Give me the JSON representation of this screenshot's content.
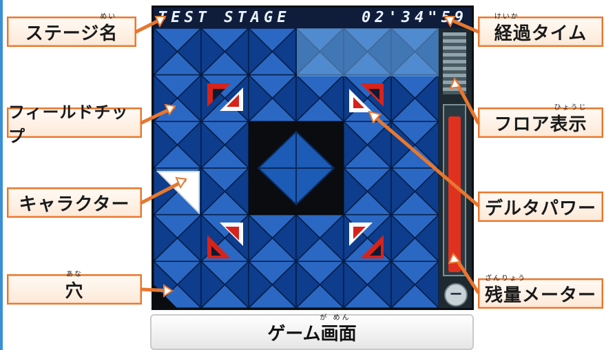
{
  "hud": {
    "stage_name": "TEST STAGE",
    "elapsed_time": "02'34\"59"
  },
  "labels": {
    "stage_name": {
      "text": "ステージ名",
      "ruby": "めい"
    },
    "field_chip": {
      "text": "フィールドチップ"
    },
    "character": {
      "text": "キャラクター"
    },
    "hole": {
      "text": "穴",
      "ruby": "あな"
    },
    "elapsed_time": {
      "text": "経過タイム",
      "ruby": "けいか"
    },
    "floor_display": {
      "text": "フロア表示",
      "ruby": "ひょうじ"
    },
    "delta_power": {
      "text": "デルタパワー"
    },
    "remaining_meter": {
      "text": "残量メーター",
      "ruby": "ざんりょう"
    }
  },
  "caption": {
    "text": "ゲーム画面",
    "ruby": "が めん"
  },
  "meter": {
    "minus_symbol": "−",
    "level": 0.92
  },
  "colors": {
    "label_border": "#e8772e",
    "tile_dark": "#0d3d8c",
    "tile_light": "#2a68c4",
    "delta_red": "#d8231a",
    "meter_red": "#e0301e"
  }
}
